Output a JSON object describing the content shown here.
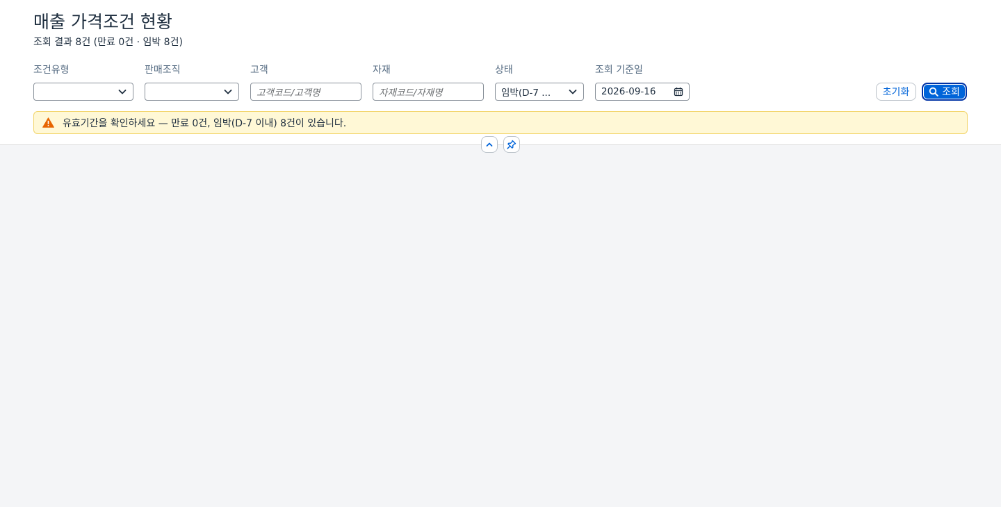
{
  "page": {
    "title": "매출 가격조건 현황",
    "subtitle": "조회 결과 8건 (만료 0건 · 임박 8건)"
  },
  "filters": {
    "condition_type": {
      "label": "조건유형",
      "value": ""
    },
    "sales_org": {
      "label": "판매조직",
      "value": ""
    },
    "customer": {
      "label": "고객",
      "placeholder": "고객코드/고객명"
    },
    "material": {
      "label": "자재",
      "placeholder": "자재코드/자재명"
    },
    "status": {
      "label": "상태",
      "value": "임박(D-7 ..."
    },
    "base_date": {
      "label": "조회 기준일",
      "value": "2026-09-16"
    }
  },
  "actions": {
    "reset_label": "초기화",
    "search_label": "조회"
  },
  "alert": {
    "message": "유효기간을 확인하세요 — 만료 0건, 임박(D-7 이내) 8건이 있습니다."
  },
  "icons": {
    "dropdown": "chevron-down-icon",
    "calendar": "calendar-icon",
    "search": "search-icon",
    "warning": "warning-icon",
    "collapse": "chevron-up-icon",
    "pin": "pin-icon"
  },
  "colors": {
    "accent": "#0064d9",
    "warning": "#e76500",
    "alert_bg": "#fff8d6"
  }
}
